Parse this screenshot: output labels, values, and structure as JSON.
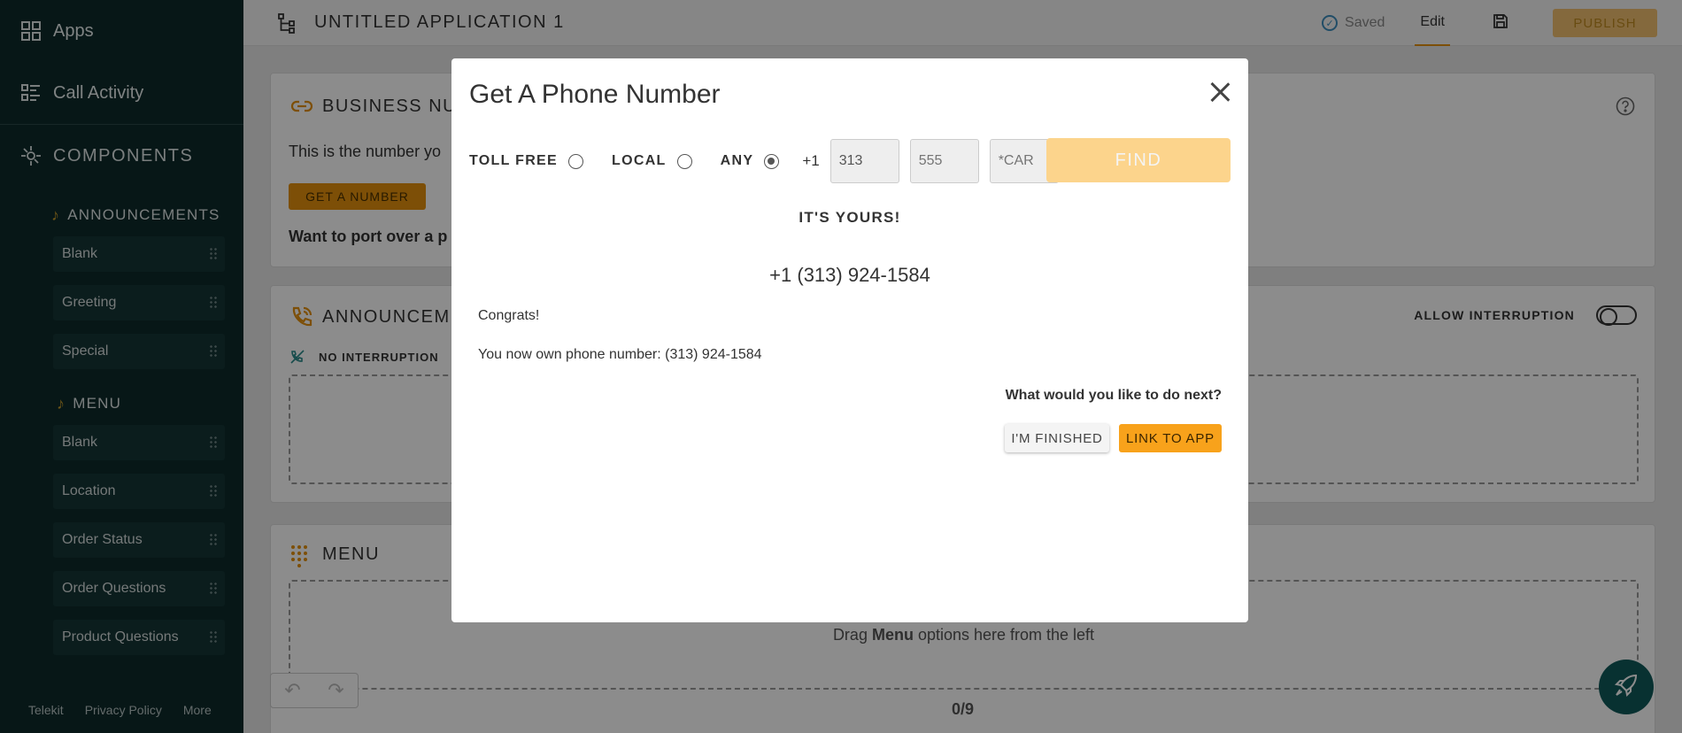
{
  "sidebar": {
    "apps_label": "Apps",
    "call_activity_label": "Call Activity",
    "components_label": "COMPONENTS",
    "announcements": {
      "heading": "ANNOUNCEMENTS",
      "items": [
        {
          "label": "Blank"
        },
        {
          "label": "Greeting"
        },
        {
          "label": "Special"
        }
      ]
    },
    "menu": {
      "heading": "MENU",
      "items": [
        {
          "label": "Blank"
        },
        {
          "label": "Location"
        },
        {
          "label": "Order Status"
        },
        {
          "label": "Order Questions"
        },
        {
          "label": "Product Questions"
        }
      ]
    },
    "footer": {
      "telekit": "Telekit",
      "privacy": "Privacy Policy",
      "more": "More"
    }
  },
  "topbar": {
    "title": "UNTITLED APPLICATION 1",
    "saved": "Saved",
    "edit": "Edit",
    "publish": "PUBLISH"
  },
  "business_card": {
    "title": "BUSINESS NUM",
    "desc": "This is the number yo",
    "get_number": "GET A NUMBER",
    "port": "Want to port over a p"
  },
  "announcements_card": {
    "title": "ANNOUNCEME",
    "no_interruption": "NO INTERRUPTION",
    "allow_interruption": "ALLOW INTERRUPTION"
  },
  "menu_card": {
    "title": "MENU",
    "drag_prefix": "Drag ",
    "drag_bold": "Menu",
    "drag_suffix": " options here from the left",
    "count": "0/9"
  },
  "modal": {
    "title": "Get A Phone Number",
    "options": {
      "toll_free": "TOLL FREE",
      "local": "LOCAL",
      "any": "ANY",
      "selected": "ANY"
    },
    "country_code": "+1",
    "area_code_value": "313",
    "prefix_placeholder": "555",
    "suffix_placeholder": "*CAR",
    "find": "FIND",
    "its_yours": "IT'S YOURS!",
    "phone_number": "+1 (313) 924-1584",
    "congrats": "Congrats!",
    "own_text": "You now own phone number: (313) 924-1584",
    "next_question": "What would you like to do next?",
    "finished": "I'M FINISHED",
    "link_to_app": "LINK TO APP"
  },
  "colors": {
    "sidebar_bg": "#0d2b2b",
    "accent": "#e4900e",
    "find_disabled": "#fcd48c",
    "link_button": "#f8a21b"
  },
  "icons": [
    "apps-grid-icon",
    "call-activity-icon",
    "components-icon",
    "music-note-icon",
    "flow-icon",
    "check-circle-icon",
    "save-icon",
    "link-icon",
    "help-icon",
    "phone-icon",
    "no-interruption-icon",
    "dialpad-icon",
    "undo-icon",
    "redo-icon",
    "rocket-icon",
    "close-icon"
  ]
}
